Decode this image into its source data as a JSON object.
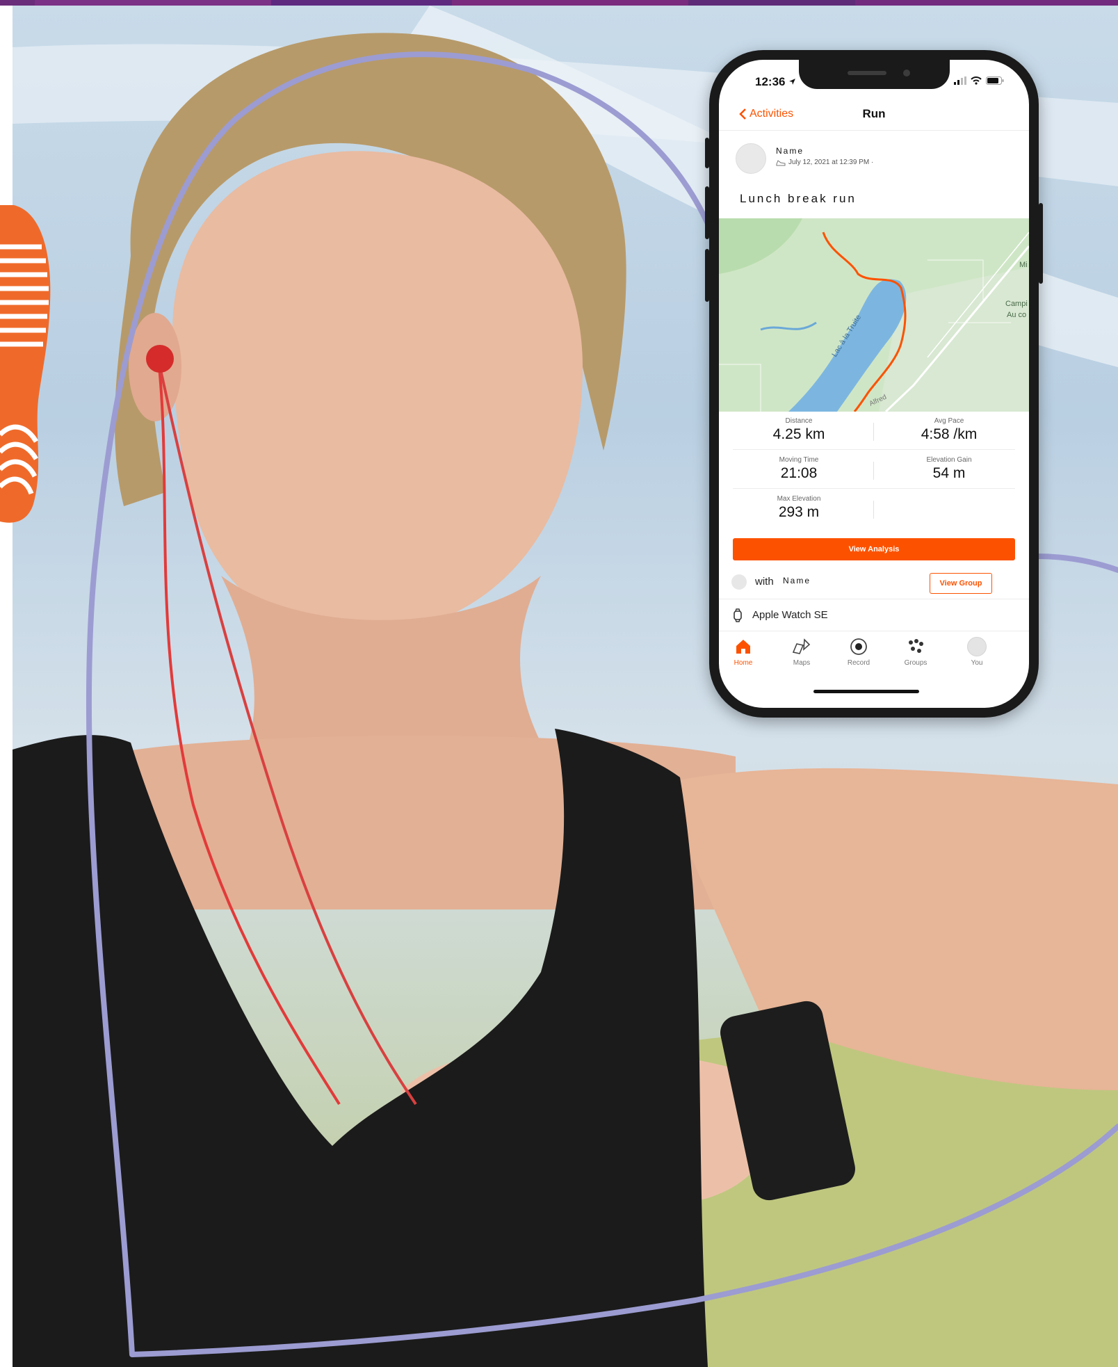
{
  "colors": {
    "accent": "#fc5200",
    "heart_outline": "#9b9bd0",
    "top_strip": "#5a2e6e"
  },
  "phone": {
    "status_bar": {
      "time": "12:36",
      "icons": [
        "location-arrow-icon",
        "signal-icon",
        "wifi-icon",
        "battery-icon"
      ]
    },
    "navbar": {
      "back_label": "Activities",
      "title": "Run"
    },
    "athlete": {
      "name": "Name",
      "date": "July 12, 2021 at 12:39 PM ·"
    },
    "activity_title": "Lunch break run",
    "map": {
      "labels": [
        "Lac à la Truite",
        "Campi",
        "Au co",
        "Mi",
        "Alfred"
      ]
    },
    "stats": [
      {
        "label": "Distance",
        "value": "4.25 km"
      },
      {
        "label": "Avg Pace",
        "value": "4:58 /km"
      },
      {
        "label": "Moving Time",
        "value": "21:08"
      },
      {
        "label": "Elevation Gain",
        "value": "54 m"
      },
      {
        "label": "Max Elevation",
        "value": "293 m"
      }
    ],
    "analysis_button": "View Analysis",
    "group": {
      "with_label": "with",
      "name": "Name",
      "button": "View Group"
    },
    "device": "Apple Watch SE",
    "tabs": [
      {
        "label": "Home",
        "icon": "home-icon",
        "active": true
      },
      {
        "label": "Maps",
        "icon": "map-icon",
        "active": false
      },
      {
        "label": "Record",
        "icon": "record-icon",
        "active": false
      },
      {
        "label": "Groups",
        "icon": "groups-icon",
        "active": false
      },
      {
        "label": "You",
        "icon": "profile-avatar-icon",
        "active": false
      }
    ]
  }
}
